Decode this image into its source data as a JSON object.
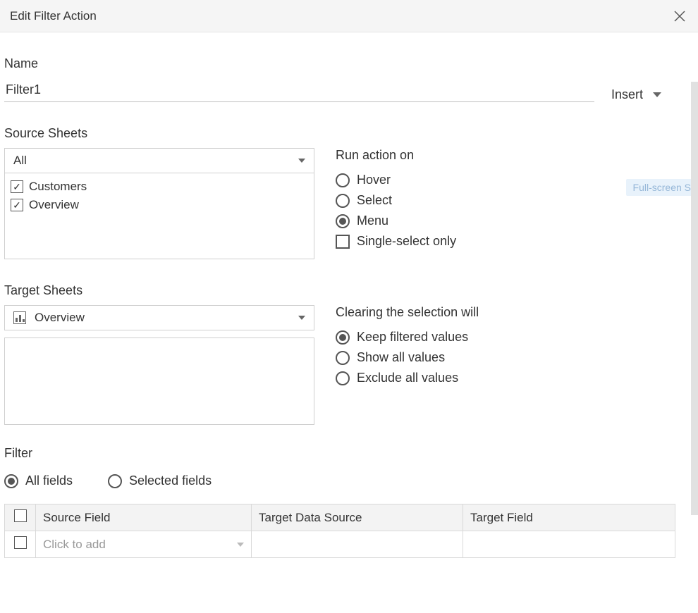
{
  "header": {
    "title": "Edit Filter Action"
  },
  "name": {
    "label": "Name",
    "value": "Filter1",
    "insertLabel": "Insert"
  },
  "sourceSheets": {
    "label": "Source Sheets",
    "dropdown": "All",
    "items": [
      {
        "label": "Customers",
        "checked": true
      },
      {
        "label": "Overview",
        "checked": true
      }
    ]
  },
  "runAction": {
    "label": "Run action on",
    "options": [
      {
        "label": "Hover",
        "selected": false
      },
      {
        "label": "Select",
        "selected": false
      },
      {
        "label": "Menu",
        "selected": true
      }
    ],
    "singleSelect": {
      "label": "Single-select only",
      "checked": false
    }
  },
  "targetSheets": {
    "label": "Target Sheets",
    "dropdown": "Overview"
  },
  "clearing": {
    "label": "Clearing the selection will",
    "options": [
      {
        "label": "Keep filtered values",
        "selected": true
      },
      {
        "label": "Show all values",
        "selected": false
      },
      {
        "label": "Exclude all values",
        "selected": false
      }
    ]
  },
  "filter": {
    "label": "Filter",
    "scope": [
      {
        "label": "All fields",
        "selected": true
      },
      {
        "label": "Selected fields",
        "selected": false
      }
    ],
    "columns": {
      "source": "Source Field",
      "targetDs": "Target Data Source",
      "targetField": "Target Field"
    },
    "addPlaceholder": "Click to add"
  },
  "pill": "Full-screen S"
}
